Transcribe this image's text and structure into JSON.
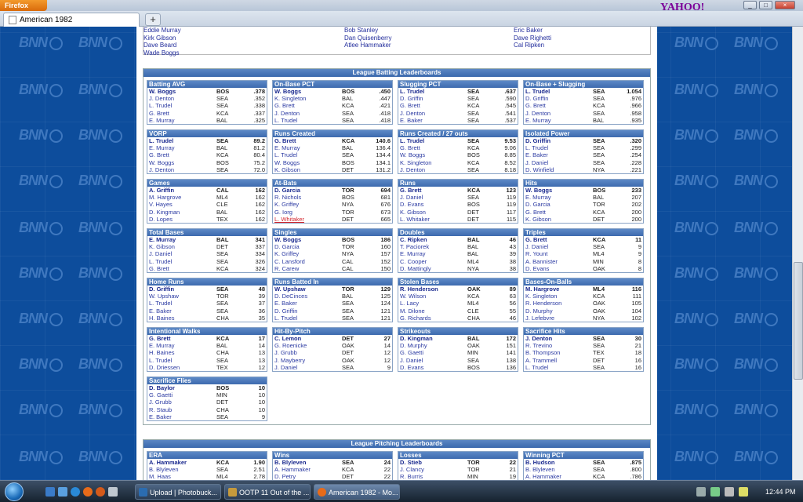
{
  "browser": {
    "menu": "Firefox",
    "tab_title": "American 1982",
    "new_tab": "+",
    "search_brand": "YAHOO!"
  },
  "watermark": "BNN",
  "top_names": [
    [
      "Eddie Murray",
      "Kirk Gibson",
      "Dave Beard",
      "Wade Boggs"
    ],
    [
      "Bob Stanley",
      "Dan Quisenberry",
      "Atlee Hammaker"
    ],
    [
      "Eric Baker",
      "Dave Righetti",
      "Cal Ripken"
    ]
  ],
  "batting": {
    "title": "League Batting Leaderboards",
    "boards": [
      {
        "title": "Batting AVG",
        "rows": [
          [
            "W. Boggs",
            "BOS",
            ".378"
          ],
          [
            "J. Denton",
            "SEA",
            ".352"
          ],
          [
            "L. Trudel",
            "SEA",
            ".338"
          ],
          [
            "G. Brett",
            "KCA",
            ".337"
          ],
          [
            "E. Murray",
            "BAL",
            ".325"
          ]
        ]
      },
      {
        "title": "On-Base PCT",
        "rows": [
          [
            "W. Boggs",
            "BOS",
            ".450"
          ],
          [
            "K. Singleton",
            "BAL",
            ".447"
          ],
          [
            "G. Brett",
            "KCA",
            ".421"
          ],
          [
            "J. Denton",
            "SEA",
            ".418"
          ],
          [
            "L. Trudel",
            "SEA",
            ".418"
          ]
        ]
      },
      {
        "title": "Slugging PCT",
        "rows": [
          [
            "L. Trudel",
            "SEA",
            ".637"
          ],
          [
            "D. Griffin",
            "SEA",
            ".590"
          ],
          [
            "G. Brett",
            "KCA",
            ".545"
          ],
          [
            "J. Denton",
            "SEA",
            ".541"
          ],
          [
            "E. Baker",
            "SEA",
            ".537"
          ]
        ]
      },
      {
        "title": "On-Base + Slugging",
        "rows": [
          [
            "L. Trudel",
            "SEA",
            "1.054"
          ],
          [
            "D. Griffin",
            "SEA",
            ".976"
          ],
          [
            "G. Brett",
            "KCA",
            ".966"
          ],
          [
            "J. Denton",
            "SEA",
            ".958"
          ],
          [
            "E. Murray",
            "BAL",
            ".935"
          ]
        ]
      },
      {
        "title": "VORP",
        "rows": [
          [
            "L. Trudel",
            "SEA",
            "89.2"
          ],
          [
            "E. Murray",
            "BAL",
            "81.2"
          ],
          [
            "G. Brett",
            "KCA",
            "80.4"
          ],
          [
            "W. Boggs",
            "BOS",
            "75.2"
          ],
          [
            "J. Denton",
            "SEA",
            "72.0"
          ]
        ]
      },
      {
        "title": "Runs Created",
        "rows": [
          [
            "G. Brett",
            "KCA",
            "140.6"
          ],
          [
            "E. Murray",
            "BAL",
            "136.4"
          ],
          [
            "L. Trudel",
            "SEA",
            "134.4"
          ],
          [
            "W. Boggs",
            "BOS",
            "134.1"
          ],
          [
            "K. Gibson",
            "DET",
            "131.2"
          ]
        ]
      },
      {
        "title": "Runs Created / 27 outs",
        "rows": [
          [
            "L. Trudel",
            "SEA",
            "9.53"
          ],
          [
            "G. Brett",
            "KCA",
            "9.06"
          ],
          [
            "W. Boggs",
            "BOS",
            "8.85"
          ],
          [
            "K. Singleton",
            "KCA",
            "8.52"
          ],
          [
            "J. Denton",
            "SEA",
            "8.18"
          ]
        ]
      },
      {
        "title": "Isolated Power",
        "rows": [
          [
            "D. Griffin",
            "SEA",
            ".320"
          ],
          [
            "L. Trudel",
            "SEA",
            ".299"
          ],
          [
            "E. Baker",
            "SEA",
            ".254"
          ],
          [
            "J. Daniel",
            "SEA",
            ".228"
          ],
          [
            "D. Winfield",
            "NYA",
            ".221"
          ]
        ]
      },
      {
        "title": "Games",
        "rows": [
          [
            "A. Griffin",
            "CAL",
            "162"
          ],
          [
            "M. Hargrove",
            "ML4",
            "162"
          ],
          [
            "V. Hayes",
            "CLE",
            "162"
          ],
          [
            "D. Kingman",
            "BAL",
            "162"
          ],
          [
            "D. Lopes",
            "TEX",
            "162"
          ]
        ]
      },
      {
        "title": "At-Bats",
        "rows": [
          [
            "D. Garcia",
            "TOR",
            "694"
          ],
          [
            "R. Nichols",
            "BOS",
            "681"
          ],
          [
            "K. Griffey",
            "NYA",
            "676"
          ],
          [
            "G. Iorg",
            "TOR",
            "673"
          ],
          [
            "L. Whitaker",
            "DET",
            "665"
          ]
        ],
        "highlight": 4
      },
      {
        "title": "Runs",
        "rows": [
          [
            "G. Brett",
            "KCA",
            "123"
          ],
          [
            "J. Daniel",
            "SEA",
            "119"
          ],
          [
            "D. Evans",
            "BOS",
            "119"
          ],
          [
            "K. Gibson",
            "DET",
            "117"
          ],
          [
            "L. Whitaker",
            "DET",
            "115"
          ]
        ]
      },
      {
        "title": "Hits",
        "rows": [
          [
            "W. Boggs",
            "BOS",
            "233"
          ],
          [
            "E. Murray",
            "BAL",
            "207"
          ],
          [
            "D. Garcia",
            "TOR",
            "202"
          ],
          [
            "G. Brett",
            "KCA",
            "200"
          ],
          [
            "K. Gibson",
            "DET",
            "200"
          ]
        ]
      },
      {
        "title": "Total Bases",
        "rows": [
          [
            "E. Murray",
            "BAL",
            "341"
          ],
          [
            "K. Gibson",
            "DET",
            "337"
          ],
          [
            "J. Daniel",
            "SEA",
            "334"
          ],
          [
            "L. Trudel",
            "SEA",
            "326"
          ],
          [
            "G. Brett",
            "KCA",
            "324"
          ]
        ]
      },
      {
        "title": "Singles",
        "rows": [
          [
            "W. Boggs",
            "BOS",
            "186"
          ],
          [
            "D. Garcia",
            "TOR",
            "160"
          ],
          [
            "K. Griffey",
            "NYA",
            "157"
          ],
          [
            "C. Lansford",
            "CAL",
            "152"
          ],
          [
            "R. Carew",
            "CAL",
            "150"
          ]
        ]
      },
      {
        "title": "Doubles",
        "rows": [
          [
            "C. Ripken",
            "BAL",
            "46"
          ],
          [
            "T. Paciorek",
            "BAL",
            "43"
          ],
          [
            "E. Murray",
            "BAL",
            "39"
          ],
          [
            "C. Cooper",
            "ML4",
            "38"
          ],
          [
            "D. Mattingly",
            "NYA",
            "38"
          ]
        ]
      },
      {
        "title": "Triples",
        "rows": [
          [
            "G. Brett",
            "KCA",
            "11"
          ],
          [
            "J. Daniel",
            "SEA",
            "9"
          ],
          [
            "R. Yount",
            "ML4",
            "9"
          ],
          [
            "A. Bannister",
            "MIN",
            "8"
          ],
          [
            "D. Evans",
            "OAK",
            "8"
          ]
        ]
      },
      {
        "title": "Home Runs",
        "rows": [
          [
            "D. Griffin",
            "SEA",
            "48"
          ],
          [
            "W. Upshaw",
            "TOR",
            "39"
          ],
          [
            "L. Trudel",
            "SEA",
            "37"
          ],
          [
            "E. Baker",
            "SEA",
            "36"
          ],
          [
            "H. Baines",
            "CHA",
            "35"
          ]
        ]
      },
      {
        "title": "Runs Batted In",
        "rows": [
          [
            "W. Upshaw",
            "TOR",
            "129"
          ],
          [
            "D. DeCinces",
            "BAL",
            "125"
          ],
          [
            "E. Baker",
            "SEA",
            "124"
          ],
          [
            "D. Griffin",
            "SEA",
            "121"
          ],
          [
            "L. Trudel",
            "SEA",
            "121"
          ]
        ]
      },
      {
        "title": "Stolen Bases",
        "rows": [
          [
            "R. Henderson",
            "OAK",
            "89"
          ],
          [
            "W. Wilson",
            "KCA",
            "63"
          ],
          [
            "L. Lacy",
            "ML4",
            "56"
          ],
          [
            "M. Dilone",
            "CLE",
            "55"
          ],
          [
            "G. Richards",
            "CHA",
            "46"
          ]
        ]
      },
      {
        "title": "Bases-On-Balls",
        "rows": [
          [
            "M. Hargrove",
            "ML4",
            "116"
          ],
          [
            "K. Singleton",
            "KCA",
            "111"
          ],
          [
            "R. Henderson",
            "OAK",
            "105"
          ],
          [
            "D. Murphy",
            "OAK",
            "104"
          ],
          [
            "J. Lefebvre",
            "NYA",
            "102"
          ]
        ]
      },
      {
        "title": "Intentional Walks",
        "rows": [
          [
            "G. Brett",
            "KCA",
            "17"
          ],
          [
            "E. Murray",
            "BAL",
            "14"
          ],
          [
            "H. Baines",
            "CHA",
            "13"
          ],
          [
            "L. Trudel",
            "SEA",
            "13"
          ],
          [
            "D. Driessen",
            "TEX",
            "12"
          ]
        ]
      },
      {
        "title": "Hit-By-Pitch",
        "rows": [
          [
            "C. Lemon",
            "DET",
            "27"
          ],
          [
            "G. Roenicke",
            "OAK",
            "14"
          ],
          [
            "J. Grubb",
            "DET",
            "12"
          ],
          [
            "J. Mayberry",
            "OAK",
            "12"
          ],
          [
            "J. Daniel",
            "SEA",
            "9"
          ]
        ]
      },
      {
        "title": "Strikeouts",
        "rows": [
          [
            "D. Kingman",
            "BAL",
            "172"
          ],
          [
            "D. Murphy",
            "OAK",
            "151"
          ],
          [
            "G. Gaetti",
            "MIN",
            "141"
          ],
          [
            "J. Daniel",
            "SEA",
            "138"
          ],
          [
            "D. Evans",
            "BOS",
            "136"
          ]
        ]
      },
      {
        "title": "Sacrifice Hits",
        "rows": [
          [
            "J. Denton",
            "SEA",
            "30"
          ],
          [
            "R. Trevino",
            "SEA",
            "21"
          ],
          [
            "B. Thompson",
            "TEX",
            "18"
          ],
          [
            "A. Trammell",
            "DET",
            "16"
          ],
          [
            "L. Trudel",
            "SEA",
            "16"
          ]
        ]
      },
      {
        "title": "Sacrifice Flies",
        "rows": [
          [
            "D. Baylor",
            "BOS",
            "10"
          ],
          [
            "G. Gaetti",
            "MIN",
            "10"
          ],
          [
            "J. Grubb",
            "DET",
            "10"
          ],
          [
            "R. Staub",
            "CHA",
            "10"
          ],
          [
            "E. Baker",
            "SEA",
            "9"
          ]
        ]
      }
    ]
  },
  "pitching": {
    "title": "League Pitching Leaderboards",
    "boards": [
      {
        "title": "ERA",
        "rows": [
          [
            "A. Hammaker",
            "KCA",
            "1.90"
          ],
          [
            "B. Blyleven",
            "SEA",
            "2.51"
          ],
          [
            "M. Haas",
            "ML4",
            "2.78"
          ]
        ]
      },
      {
        "title": "Wins",
        "rows": [
          [
            "B. Blyleven",
            "SEA",
            "24"
          ],
          [
            "A. Hammaker",
            "KCA",
            "22"
          ],
          [
            "D. Petry",
            "DET",
            "22"
          ]
        ]
      },
      {
        "title": "Losses",
        "rows": [
          [
            "D. Stieb",
            "TOR",
            "22"
          ],
          [
            "J. Clancy",
            "TOR",
            "21"
          ],
          [
            "R. Burris",
            "MIN",
            "19"
          ]
        ]
      },
      {
        "title": "Winning PCT",
        "rows": [
          [
            "B. Hudson",
            "SEA",
            ".875"
          ],
          [
            "B. Blyleven",
            "SEA",
            ".800"
          ],
          [
            "A. Hammaker",
            "KCA",
            ".786"
          ]
        ]
      }
    ]
  },
  "taskbar": {
    "tasks": [
      "Upload | Photobuck...",
      "OOTP 11 Out of the ...",
      "American 1982 - Mo..."
    ],
    "clock": "12:44 PM"
  }
}
